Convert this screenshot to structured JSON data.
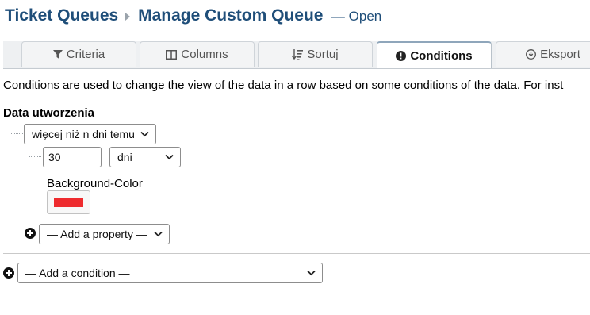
{
  "header": {
    "crumb_1": "Ticket Queues",
    "crumb_2": "Manage Custom Queue",
    "status": "— Open"
  },
  "tabs": [
    {
      "label": "Criteria",
      "icon": "filter-icon"
    },
    {
      "label": "Columns",
      "icon": "columns-icon"
    },
    {
      "label": "Sortuj",
      "icon": "sort-icon"
    },
    {
      "label": "Conditions",
      "icon": "exclamation-circle-icon",
      "active": true
    },
    {
      "label": "Eksport",
      "icon": "download-icon"
    }
  ],
  "intro_text": "Conditions are used to change the view of the data in a row based on some conditions of the data. For inst",
  "condition": {
    "field_label": "Data utworzenia",
    "operator": "więcej niż n dni temu",
    "value": "30",
    "unit": "dni",
    "property_label": "Background-Color",
    "property_color": "#ee2b2e",
    "add_property": "— Add a property —"
  },
  "add_condition": "— Add a condition —",
  "colors": {
    "title": "#1f4e79",
    "accent": "#ee2b2e"
  }
}
